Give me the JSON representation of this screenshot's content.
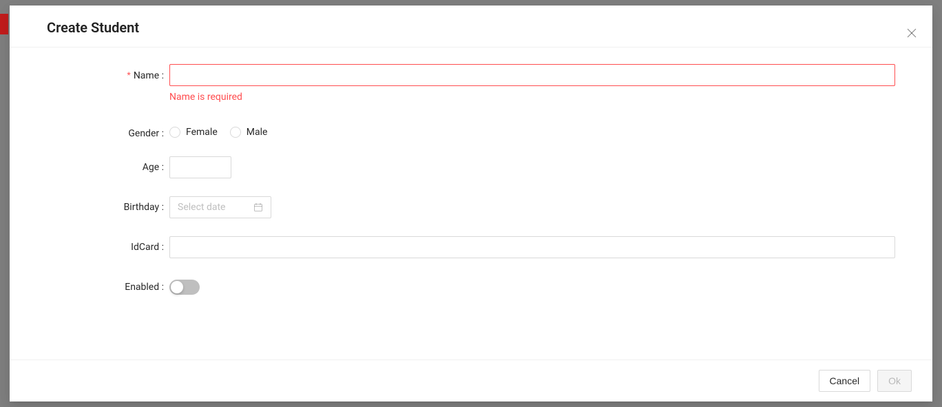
{
  "modal": {
    "title": "Create Student",
    "fields": {
      "name": {
        "label": "Name",
        "value": "",
        "error": "Name is required",
        "required": true
      },
      "gender": {
        "label": "Gender",
        "options": {
          "female": "Female",
          "male": "Male"
        }
      },
      "age": {
        "label": "Age",
        "value": ""
      },
      "birthday": {
        "label": "Birthday",
        "placeholder": "Select date",
        "value": ""
      },
      "idcard": {
        "label": "IdCard",
        "value": ""
      },
      "enabled": {
        "label": "Enabled",
        "value": false
      }
    },
    "footer": {
      "cancel": "Cancel",
      "ok": "Ok",
      "okDisabled": true
    }
  },
  "colors": {
    "error": "#ff4d4f",
    "border": "#d9d9d9",
    "textSecondary": "rgba(0,0,0,0.45)"
  }
}
